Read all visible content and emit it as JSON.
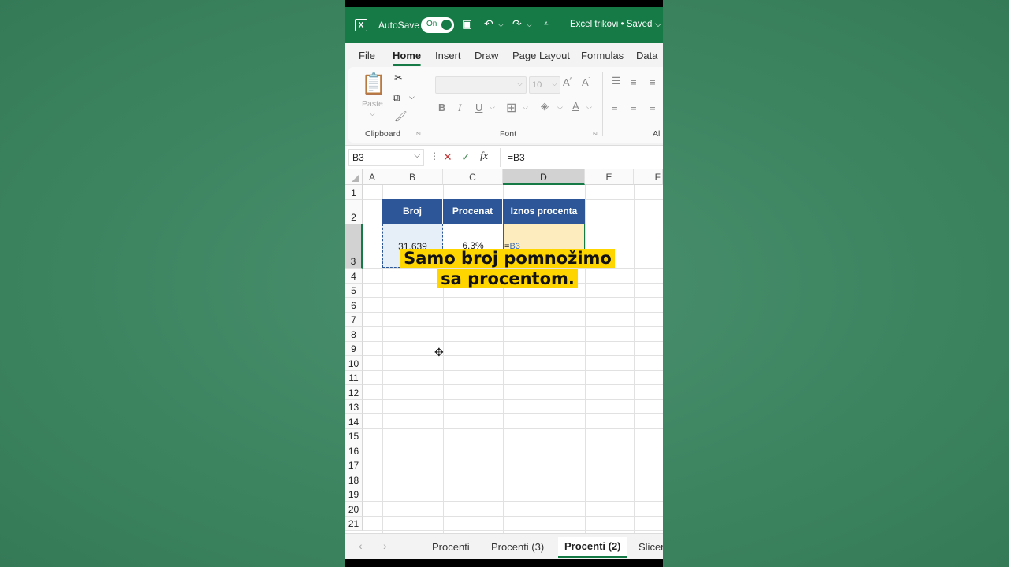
{
  "app": {
    "autosave_label": "AutoSave",
    "autosave_state": "On",
    "doc_title": "Excel trikovi • Saved ⌵",
    "accent": "#157a45"
  },
  "menu": [
    "File",
    "Home",
    "Insert",
    "Draw",
    "Page Layout",
    "Formulas",
    "Data"
  ],
  "ribbon": {
    "paste": "Paste",
    "clipboard": "Clipboard",
    "font_group": "Font",
    "font_size": "10",
    "alignment_partial": "Ali"
  },
  "formula_bar": {
    "name_box": "B3",
    "formula": "=B3"
  },
  "grid": {
    "columns": [
      "A",
      "B",
      "C",
      "D",
      "E",
      "F"
    ],
    "rows": [
      "1",
      "2",
      "3",
      "4",
      "5",
      "6",
      "7",
      "8",
      "9",
      "10",
      "11",
      "12",
      "13",
      "14",
      "15",
      "16",
      "17",
      "18",
      "19",
      "20",
      "21"
    ],
    "headers": [
      "Broj",
      "Procenat",
      "Iznos procenta"
    ],
    "values": {
      "b3": "31.639",
      "c3": "6,3%",
      "d3_eq": "=",
      "d3_ref": "B3"
    },
    "header_color": "#2c5697"
  },
  "caption": {
    "line1": "Samo broj pomnožimo",
    "line2": "sa procentom."
  },
  "sheets": [
    "Procenti",
    "Procenti (3)",
    "Procenti (2)",
    "Slicer"
  ],
  "active_sheet": "Procenti (2)"
}
